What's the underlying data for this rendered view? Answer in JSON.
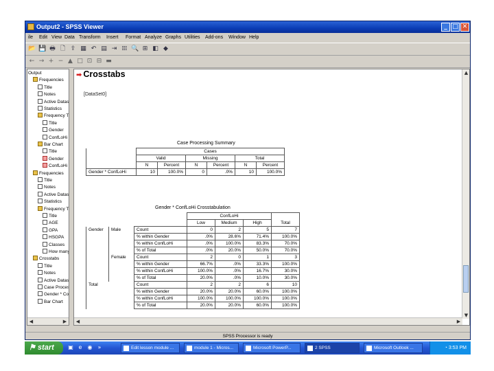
{
  "window": {
    "title": "Output2 - SPSS Viewer",
    "controls": {
      "minimize": "_",
      "maximize": "□",
      "close": "✕"
    }
  },
  "menu": [
    "ile",
    "Edit",
    "View",
    "Data",
    "Transform",
    "Insert",
    "Format",
    "Analyze",
    "Graphs",
    "Utilities",
    "Add-ons",
    "Window",
    "Help"
  ],
  "toolbar1": [
    "open-folder-icon",
    "save-icon",
    "print-icon",
    "print-preview-icon",
    "export-icon",
    "dialog-recall-icon",
    "undo-icon",
    "goto-data-icon",
    "goto-case-icon",
    "variables-icon",
    "find-icon",
    "insert-case-icon",
    "designate-window-icon",
    "select-last-output-icon"
  ],
  "toolbar2": [
    "back-icon",
    "forward-icon",
    "expand-icon",
    "collapse-icon",
    "show-icon",
    "hide-icon",
    "heading-icon",
    "title-icon",
    "text-icon"
  ],
  "outline": [
    {
      "label": "Output",
      "indent": 0,
      "icon": "none"
    },
    {
      "label": "Frequencies",
      "indent": 1,
      "icon": "book"
    },
    {
      "label": "Title",
      "indent": 2,
      "icon": "page"
    },
    {
      "label": "Notes",
      "indent": 2,
      "icon": "page"
    },
    {
      "label": "Active Dataset",
      "indent": 2,
      "icon": "page"
    },
    {
      "label": "Statistics",
      "indent": 2,
      "icon": "page"
    },
    {
      "label": "Frequency Ta",
      "indent": 2,
      "icon": "book"
    },
    {
      "label": "Title",
      "indent": 3,
      "icon": "page"
    },
    {
      "label": "Gender",
      "indent": 3,
      "icon": "page"
    },
    {
      "label": "ConfLoHi",
      "indent": 3,
      "icon": "page"
    },
    {
      "label": "Bar Chart",
      "indent": 2,
      "icon": "book"
    },
    {
      "label": "Title",
      "indent": 3,
      "icon": "page"
    },
    {
      "label": "Gender",
      "indent": 3,
      "icon": "red"
    },
    {
      "label": "ConfLoHi",
      "indent": 3,
      "icon": "red"
    },
    {
      "label": "Frequencies",
      "indent": 1,
      "icon": "book"
    },
    {
      "label": "Title",
      "indent": 2,
      "icon": "page"
    },
    {
      "label": "Notes",
      "indent": 2,
      "icon": "page"
    },
    {
      "label": "Active Datase",
      "indent": 2,
      "icon": "page"
    },
    {
      "label": "Statistics",
      "indent": 2,
      "icon": "page"
    },
    {
      "label": "Frequency Ta",
      "indent": 2,
      "icon": "book"
    },
    {
      "label": "Title",
      "indent": 3,
      "icon": "page"
    },
    {
      "label": "AGE",
      "indent": 3,
      "icon": "page"
    },
    {
      "label": "GPA",
      "indent": 3,
      "icon": "page"
    },
    {
      "label": "HSGPA",
      "indent": 3,
      "icon": "page"
    },
    {
      "label": "Classes",
      "indent": 3,
      "icon": "page"
    },
    {
      "label": "How many",
      "indent": 3,
      "icon": "page"
    },
    {
      "label": "Crosstabs",
      "indent": 1,
      "icon": "book"
    },
    {
      "label": "Title",
      "indent": 2,
      "icon": "page"
    },
    {
      "label": "Notes",
      "indent": 2,
      "icon": "page"
    },
    {
      "label": "Active Datase",
      "indent": 2,
      "icon": "page"
    },
    {
      "label": "Case Processi",
      "indent": 2,
      "icon": "page"
    },
    {
      "label": "Gender * Con",
      "indent": 2,
      "icon": "page"
    },
    {
      "label": "Bar Chart",
      "indent": 2,
      "icon": "page"
    }
  ],
  "content": {
    "heading": "Crosstabs",
    "dataset": "[DataSet0]",
    "summary": {
      "caption": "Case Processing Summary",
      "cases_header": "Cases",
      "groups": [
        "Valid",
        "Missing",
        "Total"
      ],
      "subheads": [
        "N",
        "Percent",
        "N",
        "Percent",
        "N",
        "Percent"
      ],
      "row_label": "Gender * ConfLoHi",
      "row_values": [
        "10",
        "100.0%",
        "0",
        ".0%",
        "10",
        "100.0%"
      ]
    },
    "crosstab": {
      "caption": "Gender * ConfLoHi Crosstabulation",
      "col_var": "ConfLoHi",
      "cols": [
        "Low",
        "Medium",
        "High",
        "Total"
      ],
      "row_var": "Gender",
      "rows": [
        {
          "group": "Male",
          "stat": "Count",
          "v": [
            "0",
            "2",
            "5",
            "7"
          ]
        },
        {
          "group": "",
          "stat": "% within Gender",
          "v": [
            ".0%",
            "28.6%",
            "71.4%",
            "100.0%"
          ]
        },
        {
          "group": "",
          "stat": "% within ConfLoHi",
          "v": [
            ".0%",
            "100.0%",
            "83.3%",
            "70.0%"
          ]
        },
        {
          "group": "",
          "stat": "% of Total",
          "v": [
            ".0%",
            "20.0%",
            "50.0%",
            "70.0%"
          ]
        },
        {
          "group": "Female",
          "stat": "Count",
          "v": [
            "2",
            "0",
            "1",
            "3"
          ]
        },
        {
          "group": "",
          "stat": "% within Gender",
          "v": [
            "66.7%",
            ".0%",
            "33.3%",
            "100.0%"
          ]
        },
        {
          "group": "",
          "stat": "% within ConfLoHi",
          "v": [
            "100.0%",
            ".0%",
            "16.7%",
            "30.0%"
          ]
        },
        {
          "group": "",
          "stat": "% of Total",
          "v": [
            "20.0%",
            ".0%",
            "10.0%",
            "30.0%"
          ]
        }
      ],
      "total_label": "Total",
      "total_rows": [
        {
          "stat": "Count",
          "v": [
            "2",
            "2",
            "6",
            "10"
          ]
        },
        {
          "stat": "% within Gender",
          "v": [
            "20.0%",
            "20.0%",
            "60.0%",
            "100.0%"
          ]
        },
        {
          "stat": "% within ConfLoHi",
          "v": [
            "100.0%",
            "100.0%",
            "100.0%",
            "100.0%"
          ]
        },
        {
          "stat": "% of Total",
          "v": [
            "20.0%",
            "20.0%",
            "60.0%",
            "100.0%"
          ]
        }
      ]
    }
  },
  "status": "SPSS Processor is ready",
  "taskbar": {
    "start": "start",
    "tasks": [
      {
        "label": "Edit lesson module ..."
      },
      {
        "label": "module 1 - Micros..."
      },
      {
        "label": "Microsoft PowerP..."
      },
      {
        "label": "2 SPSS"
      },
      {
        "label": "Microsoft Outlook ..."
      }
    ],
    "clock": "3:53 PM"
  }
}
